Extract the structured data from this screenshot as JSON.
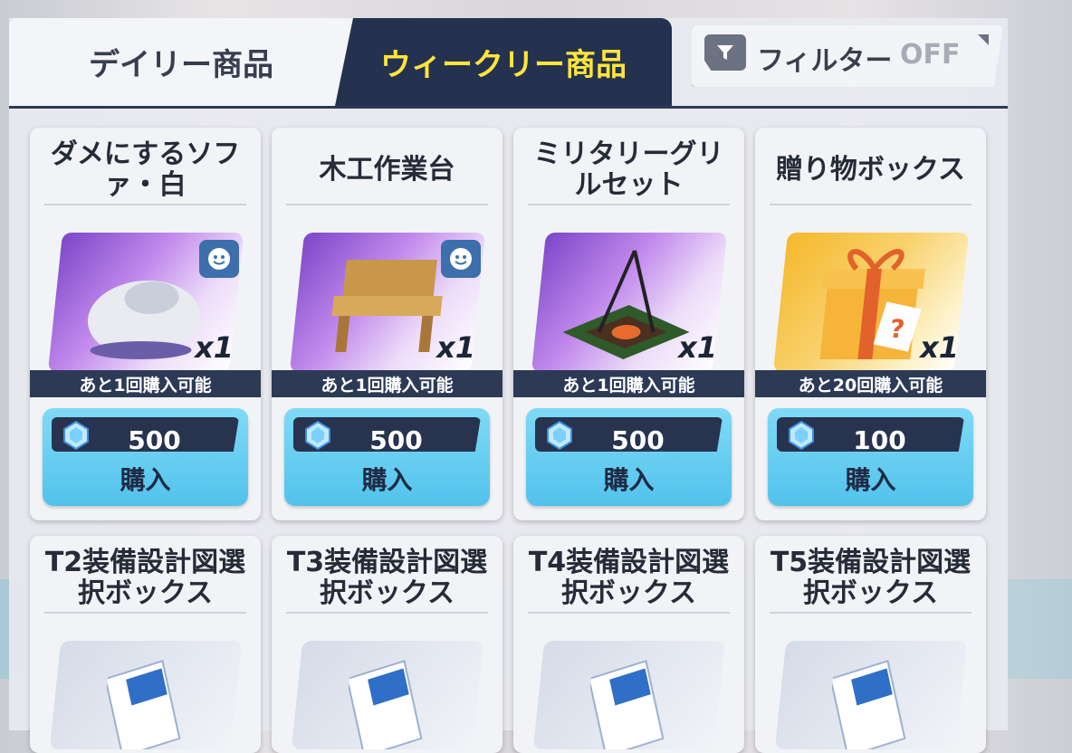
{
  "tabs": {
    "daily": "デイリー商品",
    "weekly": "ウィークリー商品"
  },
  "filter": {
    "label": "フィルター",
    "state": "OFF"
  },
  "buy_label": "購入",
  "items": [
    {
      "name": "ダメにするソファ・白",
      "qty": "x1",
      "remaining": "あと1回購入可能",
      "price": "500",
      "bg": "purple",
      "has_badge": true
    },
    {
      "name": "木工作業台",
      "qty": "x1",
      "remaining": "あと1回購入可能",
      "price": "500",
      "bg": "purple",
      "has_badge": true
    },
    {
      "name": "ミリタリーグリルセット",
      "qty": "x1",
      "remaining": "あと1回購入可能",
      "price": "500",
      "bg": "purple",
      "has_badge": false
    },
    {
      "name": "贈り物ボックス",
      "qty": "x1",
      "remaining": "あと20回購入可能",
      "price": "100",
      "bg": "gold",
      "has_badge": false
    },
    {
      "name": "T2装備設計図選択ボックス"
    },
    {
      "name": "T3装備設計図選択ボックス"
    },
    {
      "name": "T4装備設計図選択ボックス"
    },
    {
      "name": "T5装備設計図選択ボックス"
    }
  ],
  "colors": {
    "tab_active_bg": "#24324f",
    "tab_active_text": "#ffe53b",
    "buy_button": "#52c2ec",
    "remaining_bar": "#2d3a56"
  }
}
